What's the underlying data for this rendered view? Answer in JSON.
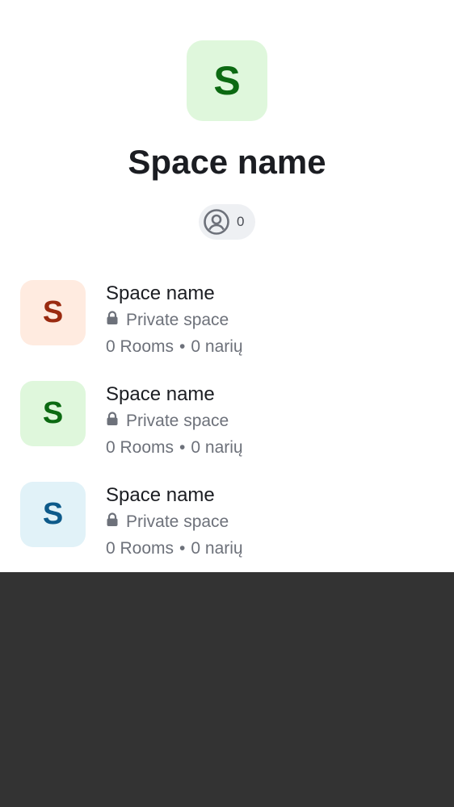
{
  "header": {
    "avatar_letter": "S",
    "avatar_bg": "#dff7dc",
    "avatar_color": "#0c6a12",
    "title": "Space name",
    "member_icon": "user-circle-icon",
    "member_count": "0"
  },
  "spaces": [
    {
      "avatar_letter": "S",
      "avatar_bg": "#ffebe0",
      "avatar_color": "#9a2a10",
      "name": "Space name",
      "privacy_icon": "lock-icon",
      "privacy": "Private space",
      "rooms": "0 Rooms",
      "separator": "•",
      "members": "0 narių"
    },
    {
      "avatar_letter": "S",
      "avatar_bg": "#dff7dc",
      "avatar_color": "#0c6a12",
      "name": "Space name",
      "privacy_icon": "lock-icon",
      "privacy": "Private space",
      "rooms": "0 Rooms",
      "separator": "•",
      "members": "0 narių"
    },
    {
      "avatar_letter": "S",
      "avatar_bg": "#e1f2f8",
      "avatar_color": "#0d5a8a",
      "name": "Space name",
      "privacy_icon": "lock-icon",
      "privacy": "Private space",
      "rooms": "0 Rooms",
      "separator": "•",
      "members": "0 narių"
    }
  ],
  "colors": {
    "sheet_bg": "#ffffff",
    "backdrop": "#333333",
    "text_primary": "#1b1d22",
    "text_secondary": "#6d717a"
  }
}
